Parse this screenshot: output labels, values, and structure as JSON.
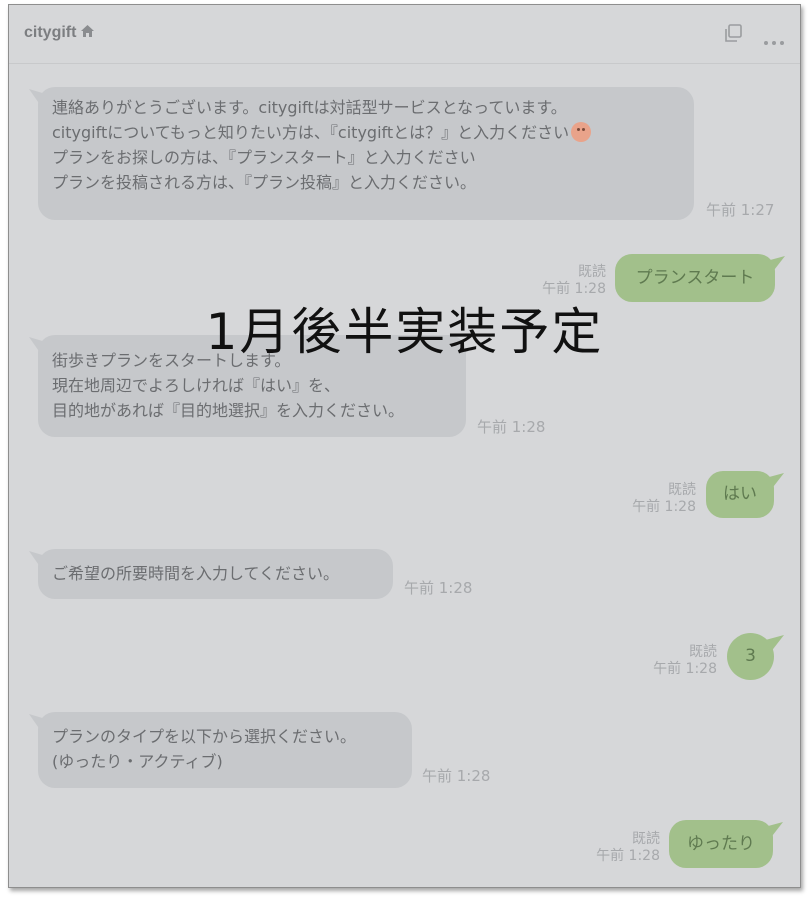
{
  "header": {
    "title": "citygift",
    "icons": [
      "home-icon",
      "copy-icon",
      "more-icon"
    ]
  },
  "messages": [
    {
      "from": "bot",
      "lines": [
        "連絡ありがとうございます。citygiftは対話型サービスとなっています。",
        "citygiftについてもっと知りたい方は、『citygiftとは？』と入力ください",
        "プランをお探しの方は、『プランスタート』と入力ください",
        "プランを投稿される方は、『プラン投稿』と入力ください。"
      ],
      "emoji": "smiling-face-emoji",
      "time": "午前 1:27"
    },
    {
      "from": "user",
      "text": "プランスタート",
      "read": "既読",
      "time": "午前 1:28"
    },
    {
      "from": "bot",
      "lines": [
        "街歩きプランをスタートします。",
        "現在地周辺でよろしければ『はい』を、",
        "目的地があれば『目的地選択』を入力ください。"
      ],
      "time": "午前 1:28"
    },
    {
      "from": "user",
      "text": "はい",
      "read": "既読",
      "time": "午前 1:28"
    },
    {
      "from": "bot",
      "lines": [
        "ご希望の所要時間を入力してください。"
      ],
      "time": "午前 1:28"
    },
    {
      "from": "user",
      "text": "3",
      "read": "既読",
      "time": "午前 1:28"
    },
    {
      "from": "bot",
      "lines": [
        "プランのタイプを以下から選択ください。",
        "(ゆったり・アクティブ)"
      ],
      "time": "午前 1:28"
    },
    {
      "from": "user",
      "text": "ゆったり",
      "read": "既読",
      "time": "午前 1:28"
    }
  ],
  "overlay": {
    "text": "1月後半実装予定"
  },
  "colors": {
    "background": "#d6d7d9",
    "bot_bubble": "#c6c8cb",
    "user_bubble": "#a2c08b"
  }
}
